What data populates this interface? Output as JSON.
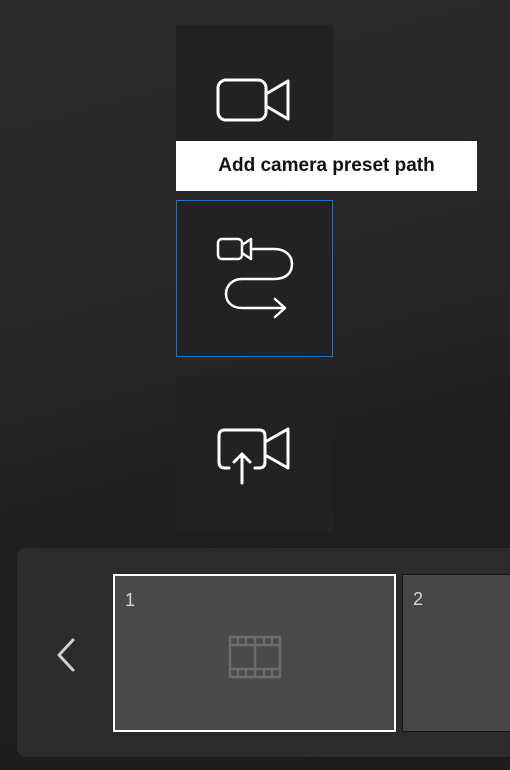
{
  "tooltip": {
    "text": "Add camera preset path"
  },
  "tools": [
    {
      "icon": "camera-icon",
      "selected": false
    },
    {
      "icon": "camera-path-icon",
      "selected": true
    },
    {
      "icon": "camera-export-icon",
      "selected": false
    }
  ],
  "timeline": {
    "prev_icon": "chevron-left-icon",
    "frames": [
      {
        "number": "1",
        "selected": true,
        "icon": "film-strip-icon"
      },
      {
        "number": "2",
        "selected": false
      }
    ]
  },
  "colors": {
    "background": "#262627",
    "tile": "#222223",
    "selection_border": "#1f6fc8",
    "icon_stroke": "#ffffff",
    "frame_fill": "#4a4a4a"
  }
}
